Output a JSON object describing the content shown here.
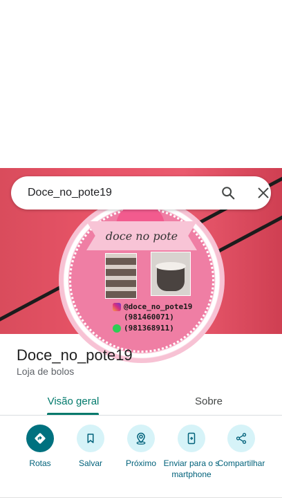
{
  "search": {
    "query": "Doce_no_pote19"
  },
  "hero": {
    "banner_text": "doce no pote",
    "instagram": "@doce_no_pote19",
    "phone1": "(981460071)",
    "phone2": "(981368911)"
  },
  "place": {
    "name": "Doce_no_pote19",
    "category": "Loja de bolos"
  },
  "tabs": [
    {
      "label": "Visão geral"
    },
    {
      "label": "Sobre"
    }
  ],
  "actions": [
    {
      "label": "Rotas",
      "icon": "directions-icon"
    },
    {
      "label": "Salvar",
      "icon": "bookmark-icon"
    },
    {
      "label": "Próximo",
      "icon": "nearby-icon"
    },
    {
      "label": "Enviar para o smartphone",
      "icon": "send-to-phone-icon"
    },
    {
      "label": "Compartilhar",
      "icon": "share-icon"
    }
  ],
  "colors": {
    "accent": "#00796b",
    "primary_action": "#00717f",
    "action_bg": "#d6f3f8"
  }
}
